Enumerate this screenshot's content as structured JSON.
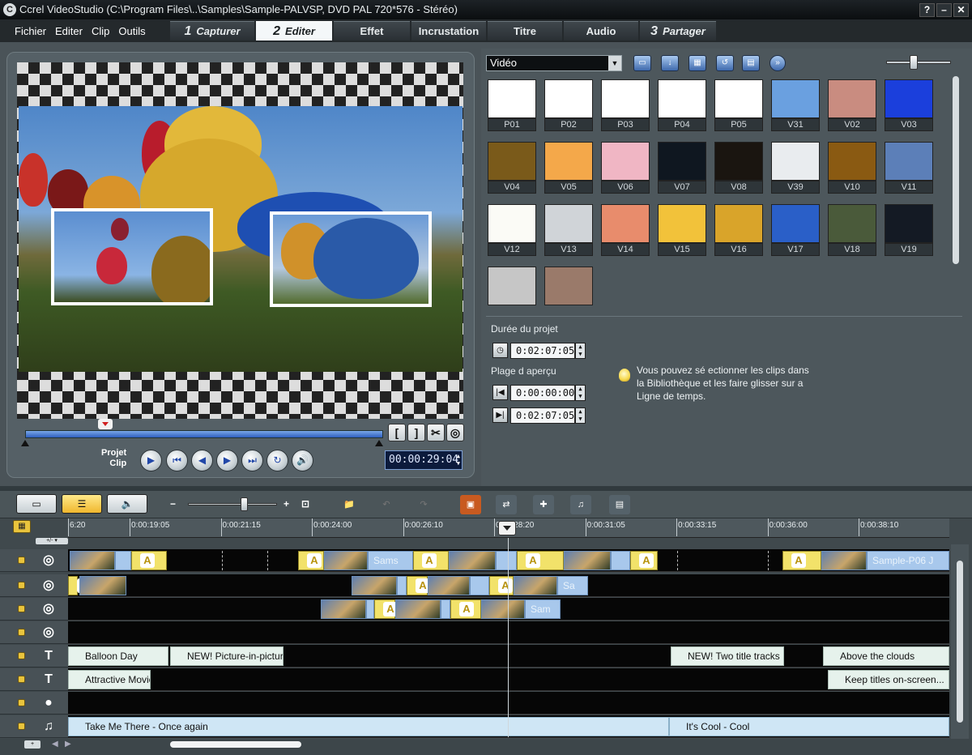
{
  "window": {
    "title": "Ccrel VideoStudio (C:\\Program Files\\..\\Samples\\Sample-PALVSP, DVD PAL 720*576 - Stéréo)",
    "controls": [
      "?",
      "–",
      "✕"
    ]
  },
  "menu": [
    "Fichier",
    "Editer",
    "Clip",
    "Outils"
  ],
  "tabs": [
    {
      "num": "1",
      "label": "Capturer"
    },
    {
      "num": "2",
      "label": "Editer",
      "active": true
    },
    {
      "label": "Effet"
    },
    {
      "label": "Incrustation"
    },
    {
      "label": "Titre"
    },
    {
      "label": "Audio"
    },
    {
      "num": "3",
      "label": "Partager"
    }
  ],
  "preview": {
    "mode_project": "Projet",
    "mode_clip": "Clip",
    "timecode": "00:00:29:04",
    "trim_tools": [
      "[",
      "]",
      "✂",
      "◎"
    ]
  },
  "library": {
    "category": "Vidéo",
    "thumbnails": [
      {
        "label": "P01",
        "color": "#ffffff"
      },
      {
        "label": "P02",
        "color": "#ffffff"
      },
      {
        "label": "P03",
        "color": "#ffffff"
      },
      {
        "label": "P04",
        "color": "#ffffff"
      },
      {
        "label": "P05",
        "color": "#ffffff"
      },
      {
        "label": "V31",
        "color": "#6aa0e0"
      },
      {
        "label": "V02",
        "color": "#c98c80"
      },
      {
        "label": "V03",
        "color": "#1b3fdc"
      },
      {
        "label": "V04",
        "color": "#7a5a1a"
      },
      {
        "label": "V05",
        "color": "#f4a84a"
      },
      {
        "label": "V06",
        "color": "#f0b6c4"
      },
      {
        "label": "V07",
        "color": "#0f1720"
      },
      {
        "label": "V08",
        "color": "#1a1510"
      },
      {
        "label": "V39",
        "color": "#e9ecef"
      },
      {
        "label": "V10",
        "color": "#8a5a12"
      },
      {
        "label": "V11",
        "color": "#5c7fb8"
      },
      {
        "label": "V12",
        "color": "#fbfbf6"
      },
      {
        "label": "V13",
        "color": "#d0d4d8"
      },
      {
        "label": "V14",
        "color": "#e88c6c"
      },
      {
        "label": "V15",
        "color": "#f2c23a"
      },
      {
        "label": "V16",
        "color": "#d9a42a"
      },
      {
        "label": "V17",
        "color": "#2a5fc8"
      },
      {
        "label": "V18",
        "color": "#4a5a3a"
      },
      {
        "label": "V19",
        "color": "#141a24"
      },
      {
        "label": "",
        "color": "#c6c6c6"
      },
      {
        "label": "",
        "color": "#9a7a6a"
      }
    ],
    "project_duration_label": "Durée du projet",
    "project_duration": "0:02:07:05",
    "preview_range_label": "Plage d aperçu",
    "range_start": "0:00:00:00",
    "range_end": "0:02:07:05",
    "hint": "Vous pouvez sé ectionner les clips dans la Bibliothèque et les faire glisser sur a Ligne de temps."
  },
  "timeline": {
    "ruler": [
      "6:20",
      "0:00:19:05",
      "0:00:21:15",
      "0:00:24:00",
      "0:00:26:10",
      "0:00:28:20",
      "0:00:31:05",
      "0:00:33:15",
      "0:00:36:00",
      "0:00:38:10"
    ],
    "video_clip_labels": [
      "Sams",
      "Sample-P06 J"
    ],
    "overlay1_labels": [
      "Sa"
    ],
    "overlay2_labels": [
      "Sam"
    ],
    "title1": [
      "Balloon Day",
      "NEW! Picture-in-picture",
      "NEW! Two title tracks",
      "Above the clouds"
    ],
    "title2": [
      "Attractive Movie",
      "Keep titles on-screen..."
    ],
    "music": [
      "Take Me There - Once again",
      "It's Cool - Cool"
    ]
  }
}
